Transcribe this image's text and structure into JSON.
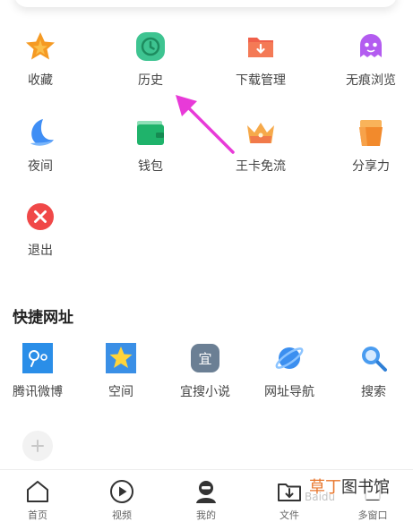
{
  "grid": {
    "items": [
      {
        "label": "收藏",
        "icon": "star-icon"
      },
      {
        "label": "历史",
        "icon": "clock-icon"
      },
      {
        "label": "下载管理",
        "icon": "download-folder-icon"
      },
      {
        "label": "无痕浏览",
        "icon": "ghost-icon"
      },
      {
        "label": "夜间",
        "icon": "moon-icon"
      },
      {
        "label": "钱包",
        "icon": "wallet-icon"
      },
      {
        "label": "王卡免流",
        "icon": "crown-icon"
      },
      {
        "label": "分享力",
        "icon": "share-cup-icon"
      },
      {
        "label": "退出",
        "icon": "exit-icon"
      }
    ]
  },
  "quick_links": {
    "title": "快捷网址",
    "items": [
      {
        "label": "腾讯微博",
        "icon": "tencent-weibo-icon"
      },
      {
        "label": "空间",
        "icon": "qzone-star-icon"
      },
      {
        "label": "宜搜小说",
        "icon": "yisou-icon",
        "glyph": "宜"
      },
      {
        "label": "网址导航",
        "icon": "planet-icon"
      },
      {
        "label": "搜索",
        "icon": "search-icon"
      }
    ]
  },
  "bottom_nav": {
    "items": [
      {
        "label": "首页",
        "icon": "home-icon"
      },
      {
        "label": "视频",
        "icon": "play-icon"
      },
      {
        "label": "我的",
        "icon": "user-icon"
      },
      {
        "label": "文件",
        "icon": "file-download-icon"
      },
      {
        "label": "多窗口",
        "icon": "windows-icon"
      }
    ]
  },
  "watermark": {
    "part_a": "草丁",
    "part_b": "图书馆",
    "baidu": "Baidu"
  },
  "colors": {
    "accent_arrow": "#e83ad8",
    "star": "#f59a23",
    "green": "#2dbd6e"
  }
}
